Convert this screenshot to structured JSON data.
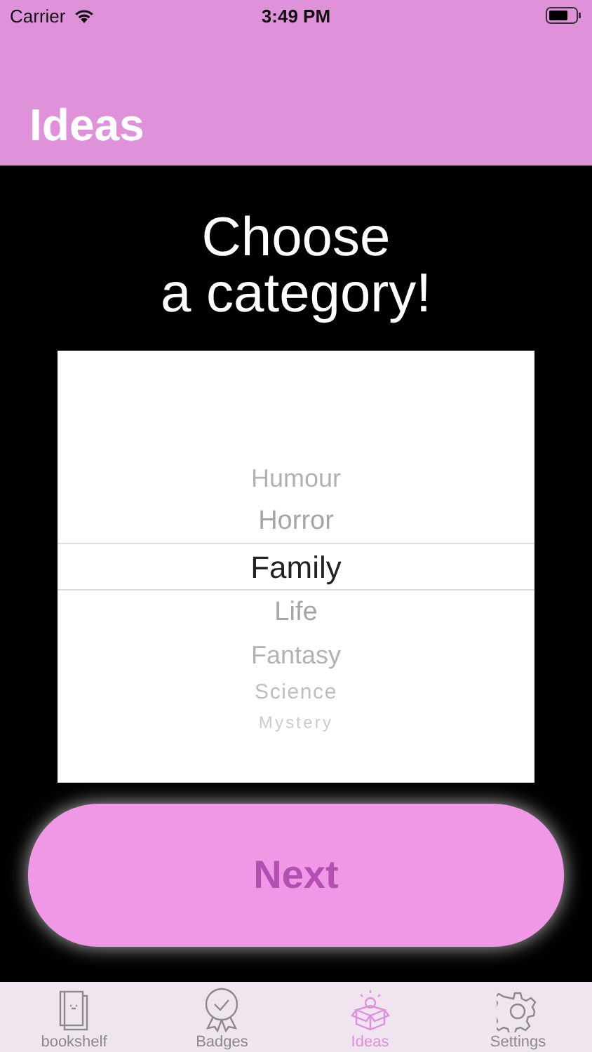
{
  "status_bar": {
    "carrier": "Carrier",
    "time": "3:49 PM"
  },
  "nav": {
    "title": "Ideas"
  },
  "heading": "Choose\na category!",
  "picker": {
    "items": [
      {
        "label": "Humour",
        "selected": false
      },
      {
        "label": "Horror",
        "selected": false
      },
      {
        "label": "Family",
        "selected": true
      },
      {
        "label": "Life",
        "selected": false
      },
      {
        "label": "Fantasy",
        "selected": false
      },
      {
        "label": "Science",
        "selected": false
      },
      {
        "label": "Mystery",
        "selected": false
      }
    ]
  },
  "next_button": "Next",
  "tabs": [
    {
      "label": "bookshelf",
      "kind": "book",
      "selected": false
    },
    {
      "label": "Badges",
      "kind": "badge",
      "selected": false
    },
    {
      "label": "Ideas",
      "kind": "idea",
      "selected": true
    },
    {
      "label": "Settings",
      "kind": "settings",
      "selected": false
    }
  ]
}
